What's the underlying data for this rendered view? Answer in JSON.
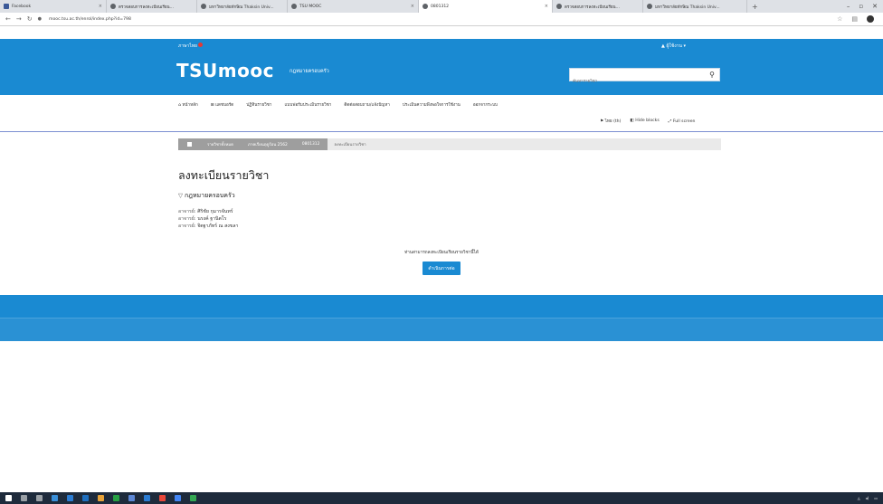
{
  "browser": {
    "tabs": [
      {
        "label": "Facebook",
        "active": false
      },
      {
        "label": "ตรวจสอบการลงทะเบียนเรียน...",
        "active": false
      },
      {
        "label": "มหาวิทยาลัยทักษิณ Thaksin Univ...",
        "active": false
      },
      {
        "label": "TSU MOOC",
        "active": false
      },
      {
        "label": "0801312",
        "active": true
      },
      {
        "label": "ตรวจสอบการลงทะเบียนเรียน...",
        "active": false
      },
      {
        "label": "มหาวิทยาลัยทักษิณ Thaksin Univ...",
        "active": false
      }
    ],
    "new_tab": "+",
    "url": "mooc.tsu.ac.th/enrol/index.php?id=798"
  },
  "header": {
    "language": "ภาษาไทย",
    "user": "ผู้ใช้งาน",
    "logo": "TSUmooc",
    "course_title": "กฎหมายครอบครัว",
    "search_placeholder": "ค้นหารายวิชา"
  },
  "menu": {
    "items": [
      "หน้าหลัก",
      "แดชบอร์ด",
      "ปฏิทินรายวิชา",
      "แบบฟอร์มประเมินรายวิชา",
      "ติดต่อสอบถาม/แจ้งปัญหา",
      "ประเมินความพึงพอใจการใช้งาน",
      "ออกจากระบบ"
    ],
    "tools": [
      "ไทย (th)",
      "Hide blocks",
      "Full screen"
    ]
  },
  "breadcrumb": [
    "รายวิชาทั้งหมด",
    "ภาคเรียนฤดูร้อน 2562",
    "0801312",
    "ลงทะเบียนรายวิชา"
  ],
  "page": {
    "title": "ลงทะเบียนรายวิชา",
    "course_name": "กฎหมายครอบครัว",
    "teachers": [
      {
        "label": "อาจารย์:",
        "name": "ศิริชัย กุมารจันทร์"
      },
      {
        "label": "อาจารย์:",
        "name": "นรงค์ ฐานิตโร"
      },
      {
        "label": "อาจารย์:",
        "name": "จิตฐาภัทร์ ณ สงขลา"
      }
    ],
    "notice": "ท่านสามารถลงทะเบียนเรียนรายวิชานี้ได้",
    "continue_label": "ดำเนินการต่อ"
  },
  "colors": {
    "brand_blue": "#1a8ad2"
  }
}
